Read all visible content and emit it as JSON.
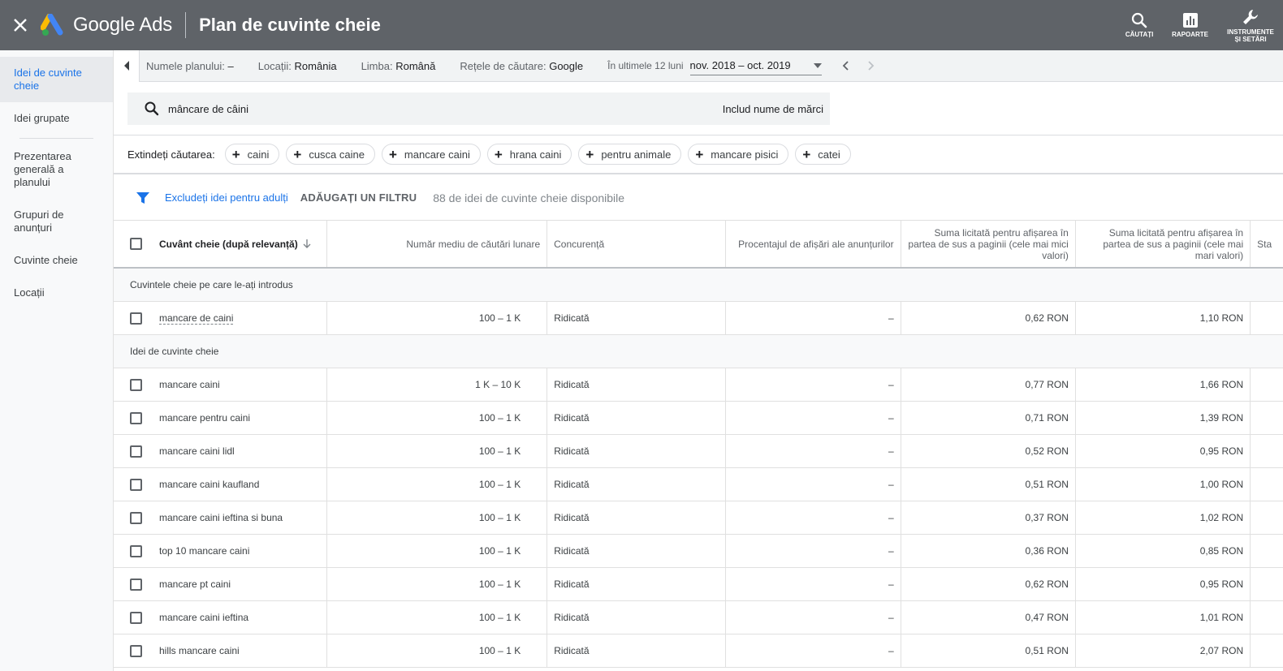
{
  "topbar": {
    "app_name": "Google Ads",
    "page_title": "Plan de cuvinte cheie",
    "actions": [
      {
        "label": "CĂUTAȚI",
        "icon": "search-icon"
      },
      {
        "label": "RAPOARTE",
        "icon": "reports-icon"
      },
      {
        "label": "INSTRUMENTE ȘI SETĂRI",
        "icon": "wrench-icon"
      }
    ]
  },
  "sidebar": {
    "items": [
      {
        "label": "Idei de cuvinte cheie",
        "active": true
      },
      {
        "label": "Idei grupate"
      },
      {
        "label": "Prezentarea generală a planului"
      },
      {
        "label": "Grupuri de anunțuri"
      },
      {
        "label": "Cuvinte cheie"
      },
      {
        "label": "Locații"
      }
    ]
  },
  "filters": {
    "plan_label": "Numele planului:",
    "plan_value": "–",
    "loc_label": "Locații:",
    "loc_value": "România",
    "lang_label": "Limba:",
    "lang_value": "Română",
    "net_label": "Rețele de căutare:",
    "net_value": "Google",
    "date_label": "În ultimele 12 luni",
    "date_value": "nov. 2018 – oct. 2019"
  },
  "search": {
    "query": "mâncare de câini",
    "brand_toggle": "Includ nume de mărci"
  },
  "expand": {
    "label": "Extindeți căutarea:",
    "chips": [
      "caini",
      "cusca caine",
      "mancare caini",
      "hrana caini",
      "pentru animale",
      "mancare pisici",
      "catei"
    ]
  },
  "toolbar": {
    "exclude_link": "Excludeți idei pentru adulți",
    "add_filter": "ADĂUGAȚI UN FILTRU",
    "available": "88 de idei de cuvinte cheie disponibile"
  },
  "table": {
    "headers": {
      "keyword": "Cuvânt cheie (după relevanță)",
      "avg": "Număr mediu de căutări lunare",
      "comp": "Concurență",
      "impr": "Procentajul de afișări ale anunțurilor",
      "low": "Suma licitată pentru afișarea în partea de sus a paginii (cele mai mici valori)",
      "high": "Suma licitată pentru afișarea în partea de sus a paginii (cele mai mari valori)",
      "stat": "Sta"
    },
    "group1": "Cuvintele cheie pe care le-ați introdus",
    "entered": [
      {
        "kw": "mancare de caini",
        "avg": "100 – 1 K",
        "comp": "Ridicată",
        "impr": "–",
        "low": "0,62 RON",
        "high": "1,10 RON"
      }
    ],
    "group2": "Idei de cuvinte cheie",
    "ideas": [
      {
        "kw": "mancare caini",
        "avg": "1 K – 10 K",
        "comp": "Ridicată",
        "impr": "–",
        "low": "0,77 RON",
        "high": "1,66 RON"
      },
      {
        "kw": "mancare pentru caini",
        "avg": "100 – 1 K",
        "comp": "Ridicată",
        "impr": "–",
        "low": "0,71 RON",
        "high": "1,39 RON"
      },
      {
        "kw": "mancare caini lidl",
        "avg": "100 – 1 K",
        "comp": "Ridicată",
        "impr": "–",
        "low": "0,52 RON",
        "high": "0,95 RON"
      },
      {
        "kw": "mancare caini kaufland",
        "avg": "100 – 1 K",
        "comp": "Ridicată",
        "impr": "–",
        "low": "0,51 RON",
        "high": "1,00 RON"
      },
      {
        "kw": "mancare caini ieftina si buna",
        "avg": "100 – 1 K",
        "comp": "Ridicată",
        "impr": "–",
        "low": "0,37 RON",
        "high": "1,02 RON"
      },
      {
        "kw": "top 10 mancare caini",
        "avg": "100 – 1 K",
        "comp": "Ridicată",
        "impr": "–",
        "low": "0,36 RON",
        "high": "0,85 RON"
      },
      {
        "kw": "mancare pt caini",
        "avg": "100 – 1 K",
        "comp": "Ridicată",
        "impr": "–",
        "low": "0,62 RON",
        "high": "0,95 RON"
      },
      {
        "kw": "mancare caini ieftina",
        "avg": "100 – 1 K",
        "comp": "Ridicată",
        "impr": "–",
        "low": "0,47 RON",
        "high": "1,01 RON"
      },
      {
        "kw": "hills mancare caini",
        "avg": "100 – 1 K",
        "comp": "Ridicată",
        "impr": "–",
        "low": "0,51 RON",
        "high": "2,07 RON"
      }
    ]
  },
  "colors": {
    "topbar": "#5f6368",
    "accent": "#1a73e8",
    "logo_blue": "#4285f4",
    "logo_yellow": "#fbbc04",
    "logo_green": "#34a853"
  }
}
